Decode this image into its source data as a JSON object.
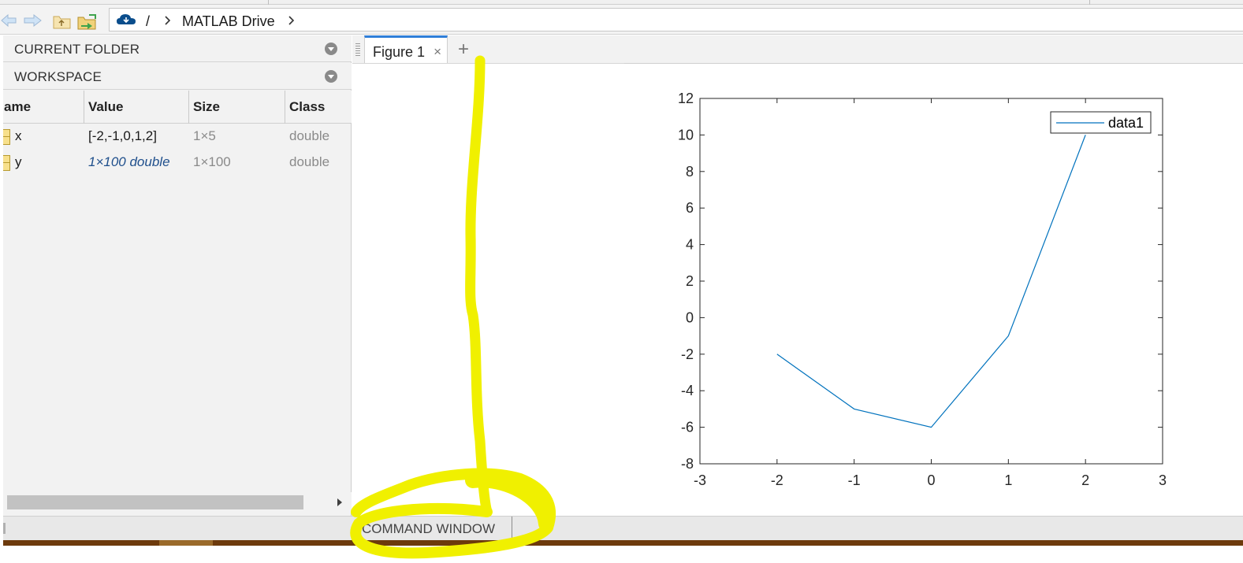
{
  "addressbar": {
    "path_root": "/",
    "path_folder": "MATLAB Drive",
    "icons": [
      "back-arrow-icon",
      "forward-arrow-icon",
      "up-folder-icon",
      "browse-folder-icon",
      "cloud-icon",
      "chevron-right-icon"
    ]
  },
  "left_panel": {
    "current_folder_label": "CURRENT FOLDER",
    "workspace_label": "WORKSPACE",
    "columns": [
      "ame",
      "Value",
      "Size",
      "Class"
    ],
    "rows": [
      {
        "name": "x",
        "value": "[-2,-1,0,1,2]",
        "size": "1×5",
        "class": "double"
      },
      {
        "name": "y",
        "value": "1×100 double",
        "size": "1×100",
        "class": "double"
      }
    ]
  },
  "figure": {
    "tab_label": "Figure 1",
    "close_glyph": "×",
    "add_tab_glyph": "+"
  },
  "command_window": {
    "label": "COMMAND WINDOW"
  },
  "annotation_color": "#f0f000",
  "chart_data": {
    "type": "line",
    "x": [
      -2,
      -1,
      0,
      1,
      2
    ],
    "series": [
      {
        "name": "data1",
        "values": [
          -2,
          -5,
          -6,
          -1,
          10
        ],
        "color": "#0072bd"
      }
    ],
    "xlim": [
      -3,
      3
    ],
    "ylim": [
      -8,
      12
    ],
    "xticks": [
      -3,
      -2,
      -1,
      0,
      1,
      2,
      3
    ],
    "yticks": [
      -8,
      -6,
      -4,
      -2,
      0,
      2,
      4,
      6,
      8,
      10,
      12
    ],
    "grid": false,
    "legend_position": "top-right",
    "title": "",
    "xlabel": "",
    "ylabel": ""
  }
}
